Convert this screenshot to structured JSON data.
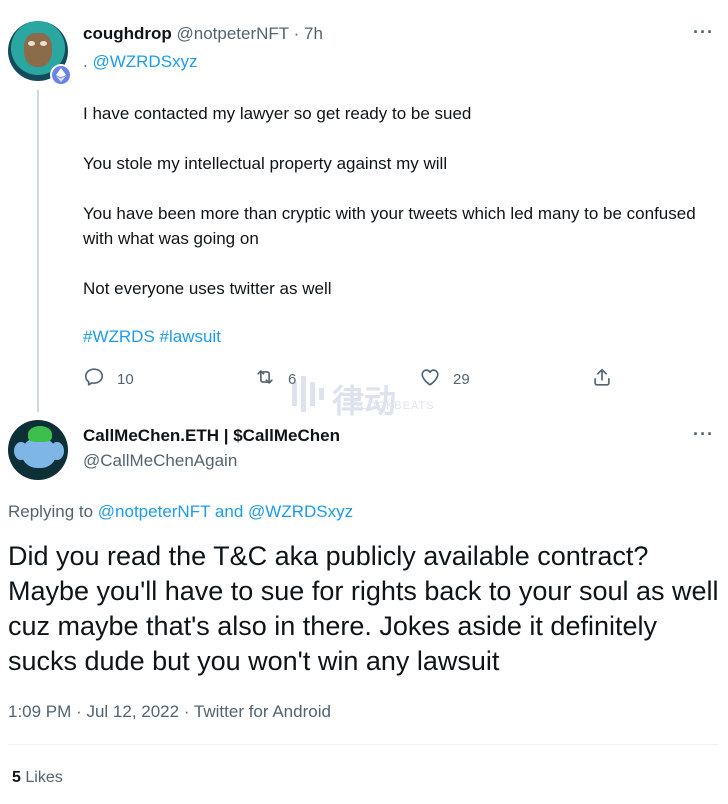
{
  "reply_tweet": {
    "author_name": "coughdrop",
    "author_handle": "@notpeterNFT",
    "separator": "·",
    "time": "7h",
    "reply_prefix": ".",
    "reply_mention": "@WZRDSxyz",
    "paragraphs": [
      "I have contacted my lawyer so get ready to be sued",
      "You stole my intellectual property against my will",
      "You have been more than cryptic with your tweets which led many to be confused with what was going on",
      "Not everyone uses twitter as well"
    ],
    "hashtags": "#WZRDS #lawsuit",
    "reply_count": "10",
    "retweet_count": "6",
    "like_count": "29"
  },
  "watermark": {
    "cn": "律动",
    "en": "BLOCKBEATS"
  },
  "main_tweet": {
    "author_name": "CallMeChen.ETH | $CallMeChen",
    "author_handle": "@CallMeChenAgain",
    "replying_to_prefix": "Replying to",
    "replying_mention_1": "@notpeterNFT",
    "replying_and": "and",
    "replying_mention_2": "@WZRDSxyz",
    "text": "Did you read the T&C aka publicly available contract? Maybe you'll have to sue for rights back to your soul as well cuz maybe that's also in there. Jokes aside it definitely sucks dude but you won't win any lawsuit",
    "time": "1:09 PM",
    "date": "Jul 12, 2022",
    "source": "Twitter for Android",
    "meta_separator": "·",
    "likes_count": "5",
    "likes_label": "Likes"
  },
  "colors": {
    "accent": "#1d9bf0",
    "secondary_text": "#536471",
    "primary_text": "#0f1419"
  }
}
